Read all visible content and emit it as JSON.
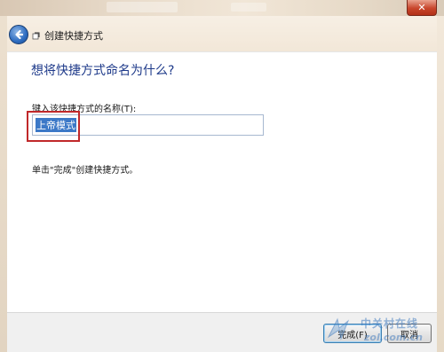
{
  "window": {
    "close_glyph": "✕",
    "title": "创建快捷方式"
  },
  "wizard": {
    "heading": "想将快捷方式命名为什么?",
    "field_label": "键入该快捷方式的名称(T):",
    "name_value": "上帝模式",
    "hint": "单击\"完成\"创建快捷方式。"
  },
  "buttons": {
    "finish_label": "完成(F)",
    "cancel_label": "取消"
  },
  "watermark": {
    "cn": "中关村在线",
    "en": "zol.com.cn"
  },
  "colors": {
    "heading": "#1e3a8a",
    "selection": "#3b78c7",
    "highlight_box": "#c0282a",
    "close_button": "#c8462c"
  },
  "icons": {
    "back": "back-arrow-icon",
    "wizard": "shortcut-wizard-icon",
    "close": "close-icon",
    "watermark_logo": "zol-logo-icon"
  }
}
